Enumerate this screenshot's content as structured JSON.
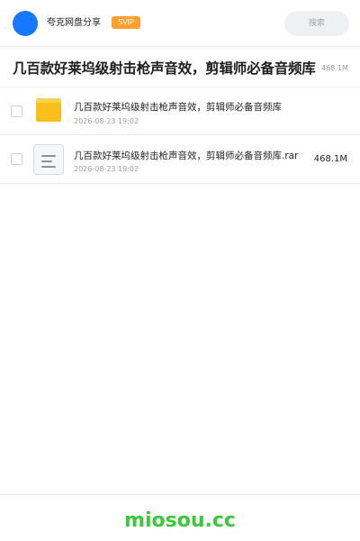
{
  "header": {
    "brand": "夸克网盘分享",
    "badge": "SVIP",
    "search_placeholder": "搜索",
    "accent_color": "#1677ff",
    "badge_color": "#ff9f2e"
  },
  "share": {
    "title": "几百款好莱坞级射击枪声音效，剪辑师必备音频库",
    "total_size": "· 468.1M"
  },
  "files": [
    {
      "name": "几百款好莱坞级射击枪声音效，剪辑师必备音频库",
      "date": "2026-08-23 19:02",
      "size": "",
      "icon": "folder-icon"
    },
    {
      "name": "几百款好莱坞级射击枪声音效，剪辑师必备音频库.rar",
      "date": "2026-08-23 19:02",
      "size": "468.1M",
      "icon": "file-icon"
    }
  ],
  "footer": {
    "site": "miosou.cc",
    "color": "#3cc83c"
  }
}
